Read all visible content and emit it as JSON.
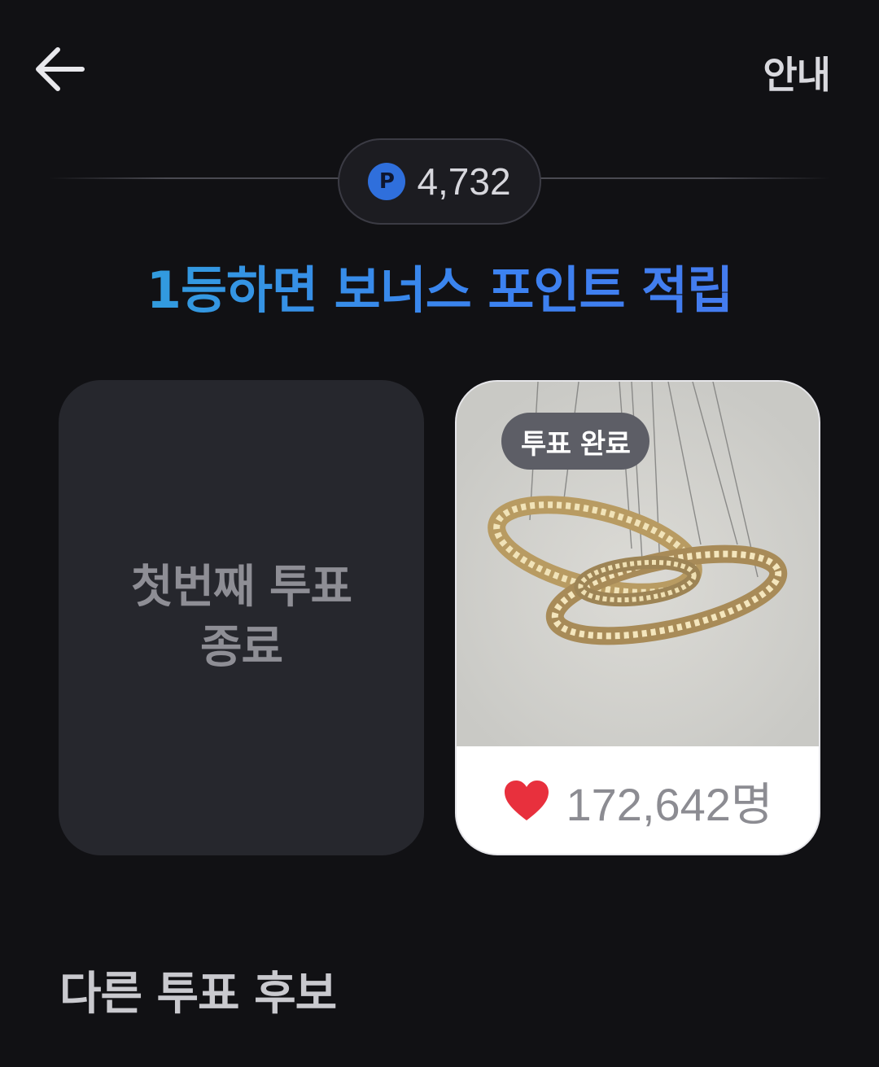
{
  "header": {
    "back_icon": "arrow-left-icon",
    "info_label": "안내"
  },
  "points": {
    "icon_letter": "P",
    "value": "4,732"
  },
  "promo": {
    "bonus_text": "1등하면 보너스 포인트 적립"
  },
  "cards": {
    "left": {
      "line1": "첫번째 투표",
      "line2": "종료"
    },
    "right": {
      "badge": "투표 완료",
      "likes": "172,642명",
      "heart_color": "#e8303d"
    }
  },
  "section": {
    "title": "다른 투표 후보"
  },
  "colors": {
    "background": "#111114",
    "accent_blue": "#3a8fe8",
    "card_dark": "#26272d"
  }
}
